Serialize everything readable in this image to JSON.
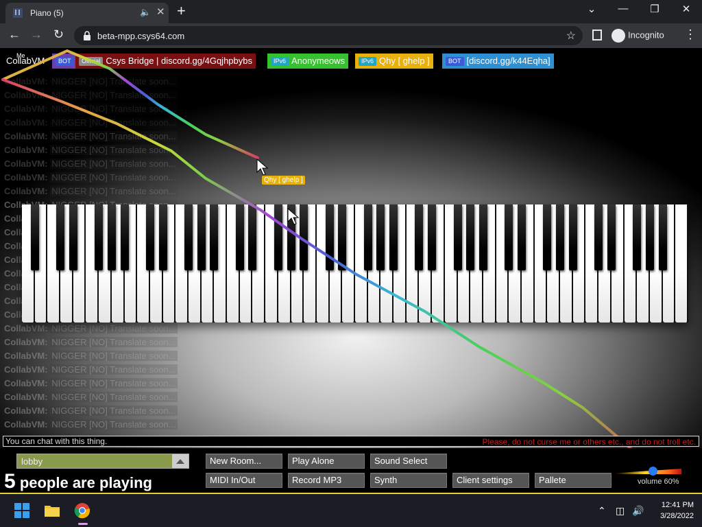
{
  "browser": {
    "tab_title": "Piano (5)",
    "url": "beta-mpp.csys64.com",
    "incognito_label": "Incognito"
  },
  "users": [
    {
      "tag": "",
      "name": "CollabVM",
      "bg": "#000000",
      "tag_bg": ""
    },
    {
      "tag": "BOT",
      "name": "",
      "bg": "#6a3fb0",
      "tag_bg": "#3b5bd6"
    },
    {
      "tag": "Official",
      "name": "Csys Bridge | discord.gg/4Gqjhpbybs",
      "bg": "#7a0f12",
      "tag_bg": "#8a8a8a"
    },
    {
      "tag": "IPv6",
      "name": "Anonymeows",
      "bg": "#36c12e",
      "tag_bg": "#22a6c8"
    },
    {
      "tag": "IPv6",
      "name": "Qhy [ ghelp ]",
      "bg": "#e8b10c",
      "tag_bg": "#22a6c8"
    },
    {
      "tag": "BOT",
      "name": "[discord.gg/k44Eqha]",
      "bg": "#2f8fd3",
      "tag_bg": "#3b5bd6"
    }
  ],
  "me_label": "Me",
  "chat": {
    "sender": "CollabVM:",
    "message": "NIGGER [NO] Translate soon...",
    "line_count": 26
  },
  "cursor_label": "Qhy [ ghelp ]",
  "chat_input": {
    "placeholder": "You can chat with this thing.",
    "warning": "Please, do not curse me or others etc., and do not troll etc."
  },
  "room": {
    "name": "lobby"
  },
  "people": {
    "count": "5",
    "suffix": "people are playing"
  },
  "buttons": {
    "new_room": "New Room...",
    "play_alone": "Play Alone",
    "sound_select": "Sound Select",
    "midi": "MIDI In/Out",
    "record": "Record MP3",
    "synth": "Synth",
    "client_settings": "Client settings",
    "pallete": "Pallete"
  },
  "volume": {
    "label": "volume 60%",
    "level": 0.6
  },
  "clock": {
    "time": "12:41 PM",
    "date": "3/28/2022"
  }
}
